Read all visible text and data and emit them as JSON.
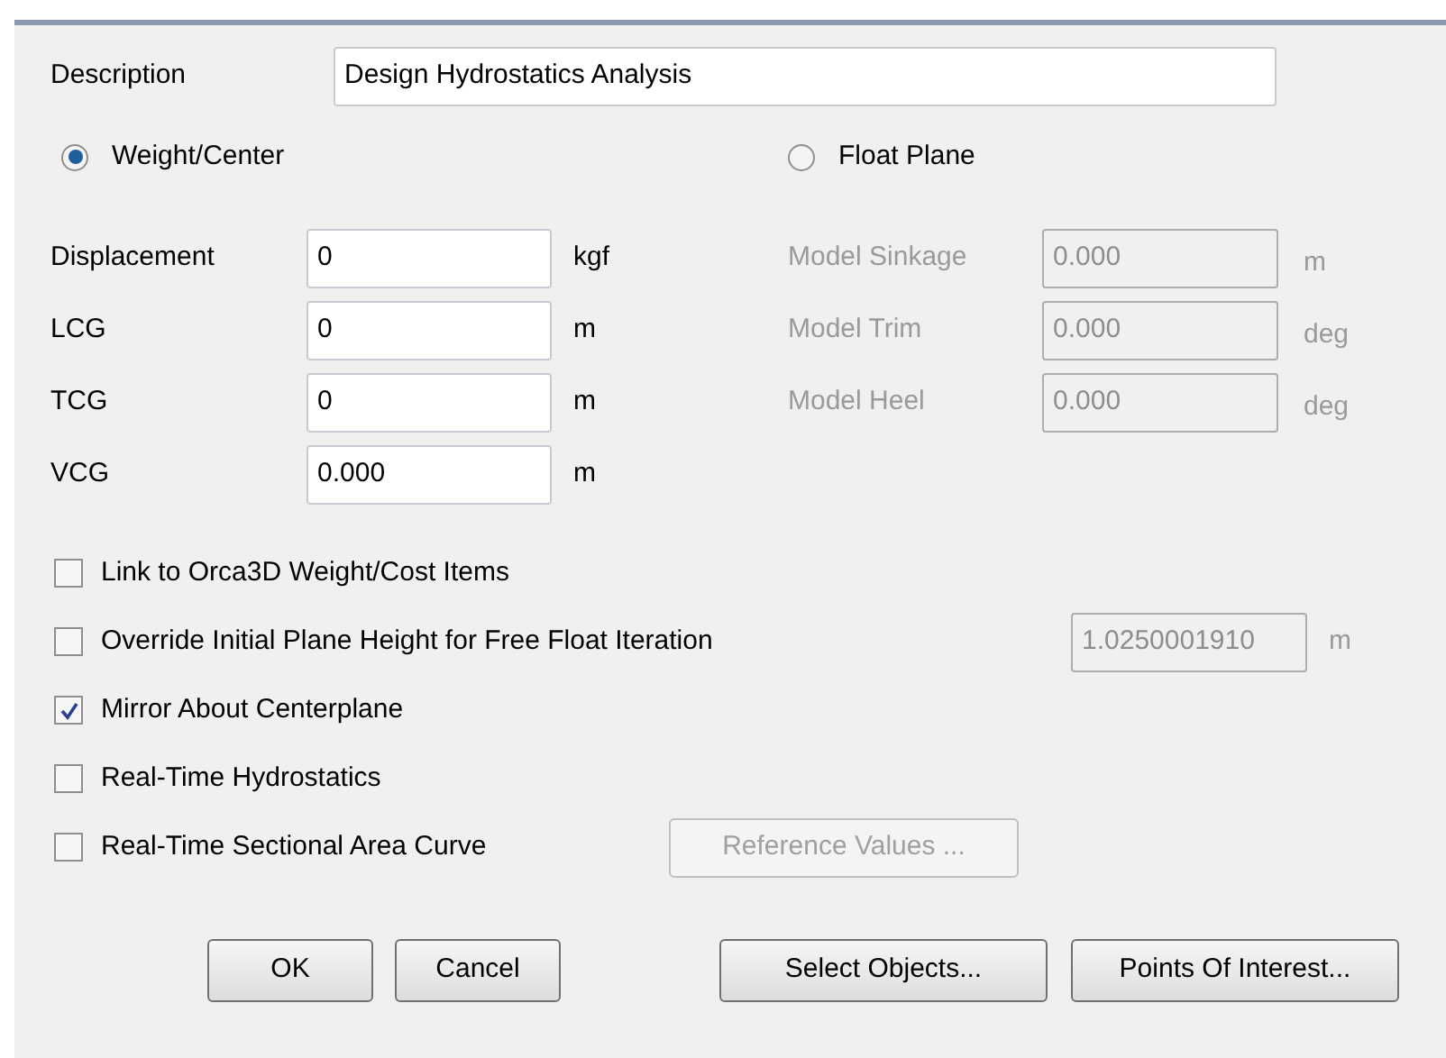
{
  "description": {
    "label": "Description",
    "value": "Design Hydrostatics Analysis"
  },
  "modes": [
    {
      "label": "Weight/Center",
      "selected": true
    },
    {
      "label": "Float Plane",
      "selected": false
    }
  ],
  "weight_fields": [
    {
      "label": "Displacement",
      "value": "0",
      "unit": "kgf"
    },
    {
      "label": "LCG",
      "value": "0",
      "unit": "m"
    },
    {
      "label": "TCG",
      "value": "0",
      "unit": "m"
    },
    {
      "label": "VCG",
      "value": "0.000",
      "unit": "m"
    }
  ],
  "float_fields": [
    {
      "label": "Model Sinkage",
      "value": "0.000",
      "unit": "m",
      "disabled": true
    },
    {
      "label": "Model Trim",
      "value": "0.000",
      "unit": "deg",
      "disabled": true
    },
    {
      "label": "Model Heel",
      "value": "0.000",
      "unit": "deg",
      "disabled": true
    }
  ],
  "options": [
    {
      "label": "Link to Orca3D Weight/Cost Items",
      "checked": false
    },
    {
      "label": "Override Initial Plane Height for Free Float Iteration",
      "checked": false,
      "field": {
        "value": "1.0250001910",
        "unit": "m",
        "disabled": true
      }
    },
    {
      "label": "Mirror About Centerplane",
      "checked": true
    },
    {
      "label": "Real-Time Hydrostatics",
      "checked": false
    },
    {
      "label": "Real-Time Sectional Area Curve",
      "checked": false,
      "button": {
        "label": "Reference Values ...",
        "disabled": true
      }
    }
  ],
  "buttons": [
    "OK",
    "Cancel",
    "Select Objects...",
    "Points Of Interest..."
  ]
}
